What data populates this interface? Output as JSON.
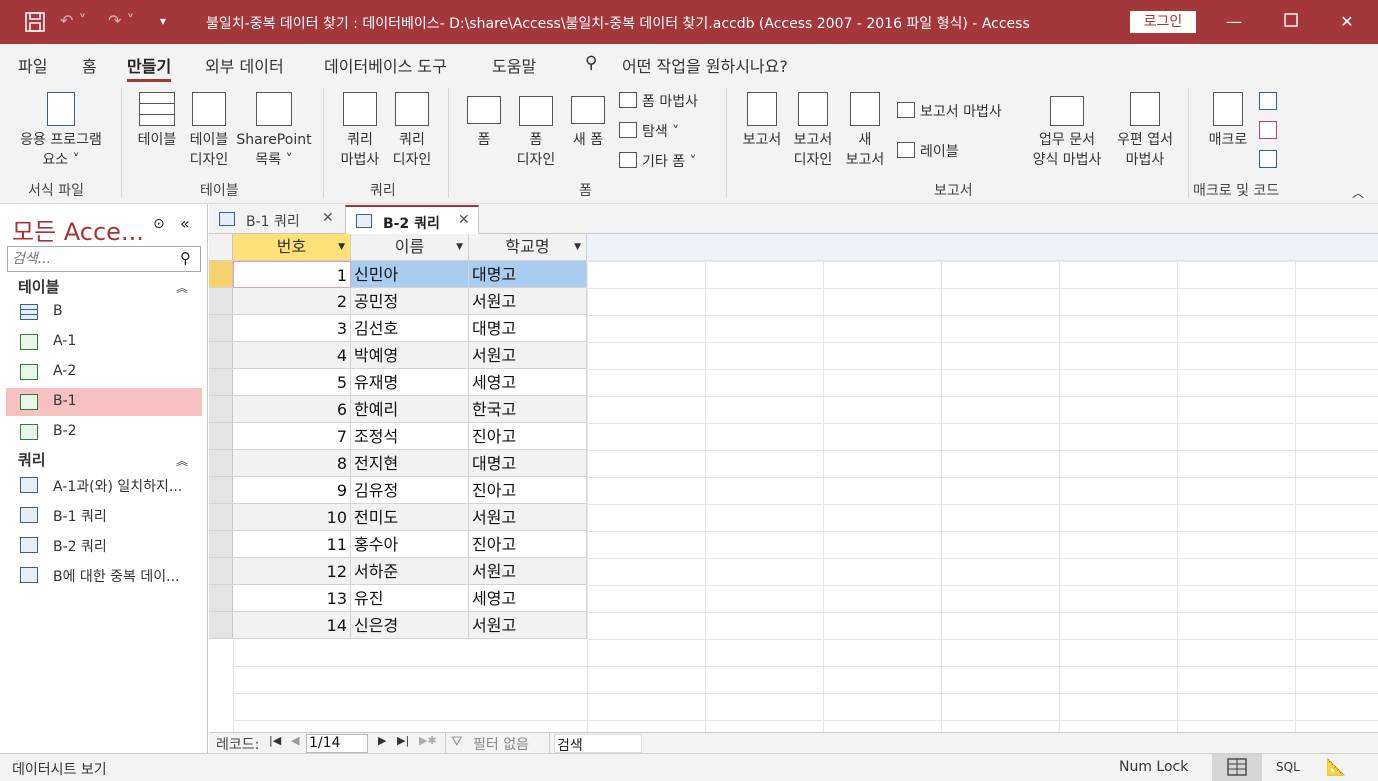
{
  "title_bar": {
    "title": "불일치-중복 데이터 찾기 : 데이터베이스- D:\\share\\Access\\불일치-중복 데이터 찾기.accdb (Access 2007 - 2016 파일 형식)  -  Access",
    "login_label": "로그인",
    "save_icon": "save-icon",
    "undo_icon": "undo-icon",
    "redo_icon": "redo-icon",
    "customize_icon": "customize-toolbar-icon",
    "brand_color": "#a4373a"
  },
  "menu": {
    "tabs": [
      "파일",
      "홈",
      "만들기",
      "외부 데이터",
      "데이터베이스 도구",
      "도움말"
    ],
    "active_tab": "만들기",
    "tell_me": "어떤 작업을 원하시나요?"
  },
  "ribbon": {
    "groups": {
      "templates": {
        "label": "서식 파일",
        "app_parts": "응용 프로그램",
        "app_parts2": "요소 ˅"
      },
      "tables": {
        "label": "테이블",
        "table": "테이블",
        "table_design1": "테이블",
        "table_design2": "디자인",
        "sharepoint1": "SharePoint",
        "sharepoint2": "목록 ˅"
      },
      "queries": {
        "label": "쿼리",
        "wizard1": "쿼리",
        "wizard2": "마법사",
        "design1": "쿼리",
        "design2": "디자인"
      },
      "forms": {
        "label": "폼",
        "form": "폼",
        "form_design1": "폼",
        "form_design2": "디자인",
        "blank_form": "새 폼",
        "form_wizard": "폼 마법사",
        "navigation": "탐색 ˅",
        "more_forms": "기타 폼 ˅"
      },
      "reports": {
        "label": "보고서",
        "report": "보고서",
        "report_design1": "보고서",
        "report_design2": "디자인",
        "blank_report1": "새",
        "blank_report2": "보고서",
        "report_wizard": "보고서 마법사",
        "labels": "레이블",
        "biz_wizard1": "업무 문서",
        "biz_wizard2": "양식 마법사",
        "postcard1": "우편 엽서",
        "postcard2": "마법사"
      },
      "macros": {
        "label": "매크로 및 코드",
        "macro": "매크로"
      }
    }
  },
  "nav_pane": {
    "title": "모든 Acce...",
    "search_placeholder": "검색...",
    "sections": [
      {
        "header": "테이블",
        "items": [
          {
            "label": "B",
            "icon": "table-icon",
            "selected": false
          },
          {
            "label": "A-1",
            "icon": "linked-excel-icon",
            "selected": false
          },
          {
            "label": "A-2",
            "icon": "linked-excel-icon",
            "selected": false
          },
          {
            "label": "B-1",
            "icon": "linked-excel-icon",
            "selected": true
          },
          {
            "label": "B-2",
            "icon": "linked-excel-icon",
            "selected": false
          }
        ]
      },
      {
        "header": "쿼리",
        "items": [
          {
            "label": "A-1과(와) 일치하지...",
            "icon": "query-icon",
            "selected": false
          },
          {
            "label": "B-1 쿼리",
            "icon": "query-icon",
            "selected": false
          },
          {
            "label": "B-2 쿼리",
            "icon": "query-icon",
            "selected": false
          },
          {
            "label": "B에 대한 중복 데이...",
            "icon": "query-icon",
            "selected": false
          }
        ]
      }
    ]
  },
  "doc_tabs": [
    {
      "label": "B-1 쿼리",
      "active": false
    },
    {
      "label": "B-2 쿼리",
      "active": true
    }
  ],
  "datasheet": {
    "columns": [
      "번호",
      "이름",
      "학교명"
    ],
    "rows": [
      [
        1,
        "신민아",
        "대명고"
      ],
      [
        2,
        "공민정",
        "서원고"
      ],
      [
        3,
        "김선호",
        "대명고"
      ],
      [
        4,
        "박예영",
        "서원고"
      ],
      [
        5,
        "유재명",
        "세영고"
      ],
      [
        6,
        "한예리",
        "한국고"
      ],
      [
        7,
        "조정석",
        "진아고"
      ],
      [
        8,
        "전지현",
        "대명고"
      ],
      [
        9,
        "김유정",
        "진아고"
      ],
      [
        10,
        "전미도",
        "서원고"
      ],
      [
        11,
        "홍수아",
        "진아고"
      ],
      [
        12,
        "서하준",
        "서원고"
      ],
      [
        13,
        "유진",
        "세영고"
      ],
      [
        14,
        "신은경",
        "서원고"
      ]
    ],
    "selected_row": 1
  },
  "record_nav": {
    "label": "레코드:",
    "position": "1/14",
    "filter": "필터 없음",
    "search": "검색"
  },
  "status_bar": {
    "view": "데이터시트 보기",
    "numlock": "Num Lock",
    "sql": "SQL"
  }
}
